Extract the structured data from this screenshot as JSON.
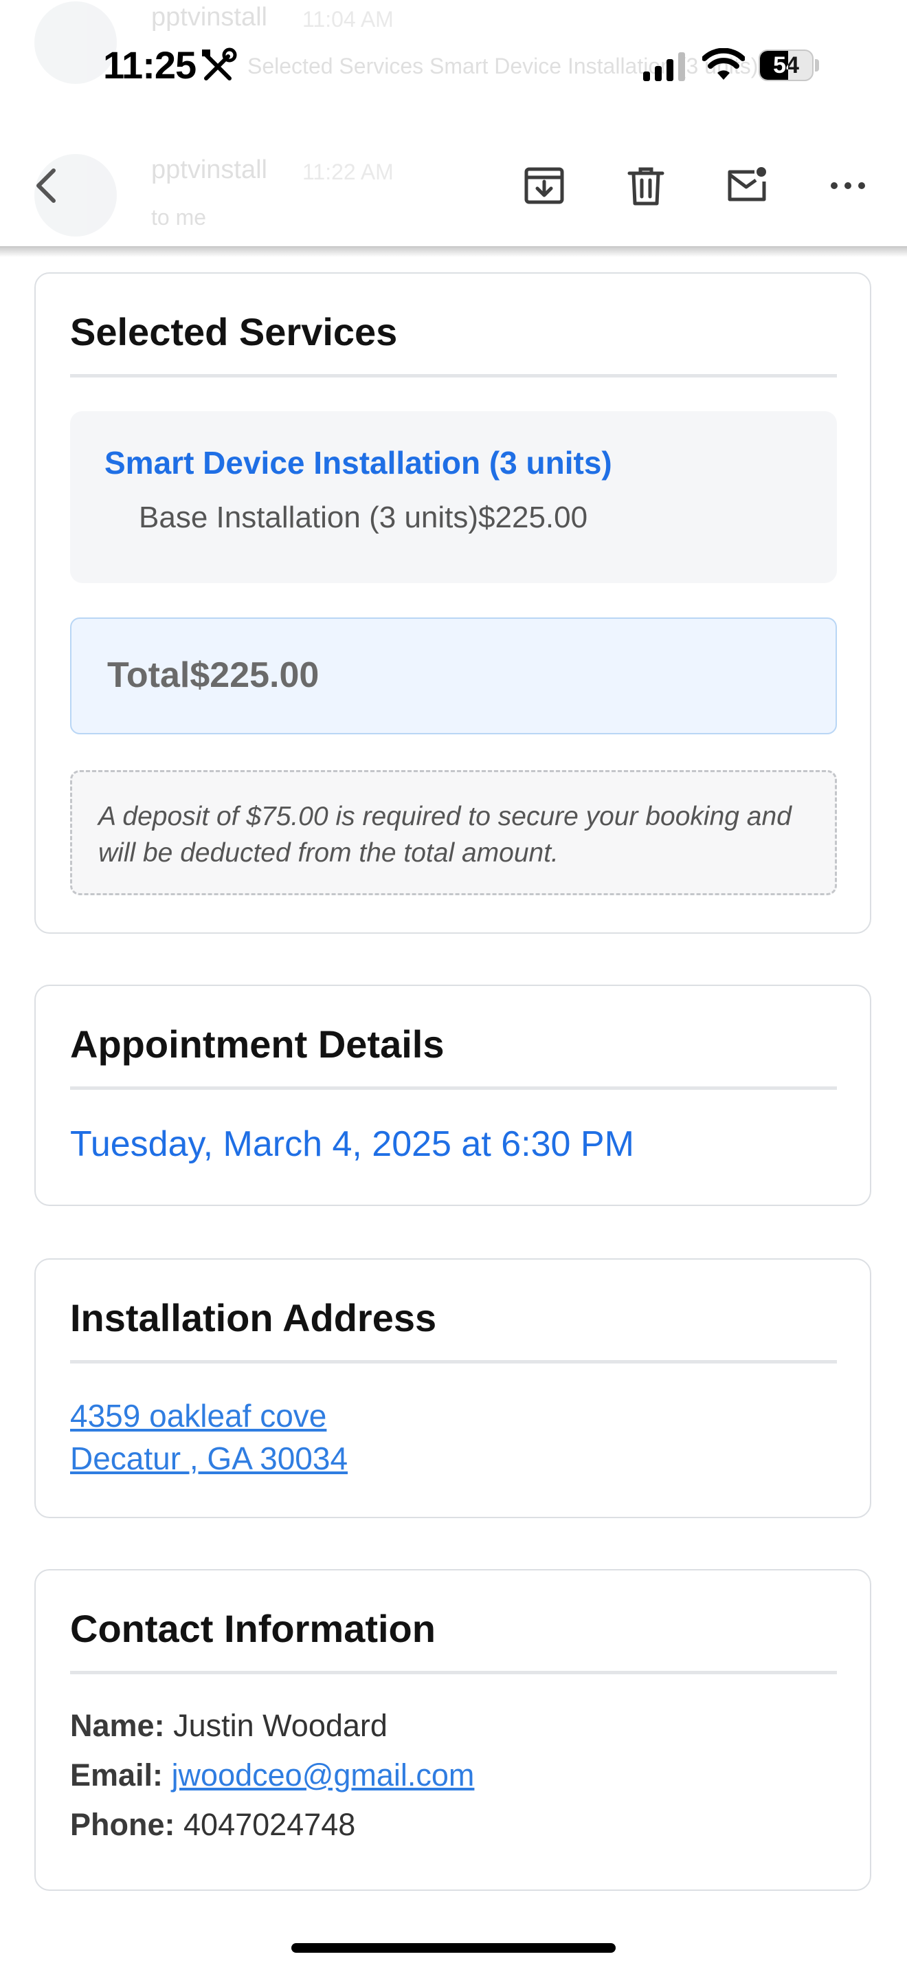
{
  "thread": {
    "messages": [
      {
        "sender": "pptvinstall",
        "time": "11:04 AM",
        "snippet": "Selected Services Smart Device Installation (3 units)..."
      },
      {
        "sender": "pptvinstall",
        "time": "11:22 AM",
        "recipient": "to me"
      }
    ]
  },
  "status_bar": {
    "time": "11:25",
    "battery_level": "54"
  },
  "toolbar": {
    "icons": [
      "back-chevron-icon",
      "archive-icon",
      "trash-icon",
      "mark-unread-icon",
      "more-icon"
    ]
  },
  "selected_services": {
    "heading": "Selected Services",
    "service_name": "Smart Device Installation (3 units)",
    "line_item": "Base Installation (3 units)$225.00",
    "total": "Total$225.00",
    "deposit_note": "A deposit of $75.00 is required to secure your booking and will be deducted from the total amount."
  },
  "appointment": {
    "heading": "Appointment Details",
    "datetime": "Tuesday, March 4, 2025 at 6:30 PM"
  },
  "address": {
    "heading": "Installation Address",
    "line1": "4359 oakleaf cove",
    "line2": "Decatur , GA 30034"
  },
  "contact": {
    "heading": "Contact Information",
    "name_label": "Name:",
    "name": "Justin Woodard",
    "email_label": "Email:",
    "email": "jwoodceo@gmail.com",
    "phone_label": "Phone:",
    "phone": "4047024748"
  },
  "colors": {
    "accent_blue": "#1f6fe5",
    "link_blue": "#2f7de1",
    "card_border": "#dcdfe3",
    "total_bg": "#eef5ff"
  }
}
